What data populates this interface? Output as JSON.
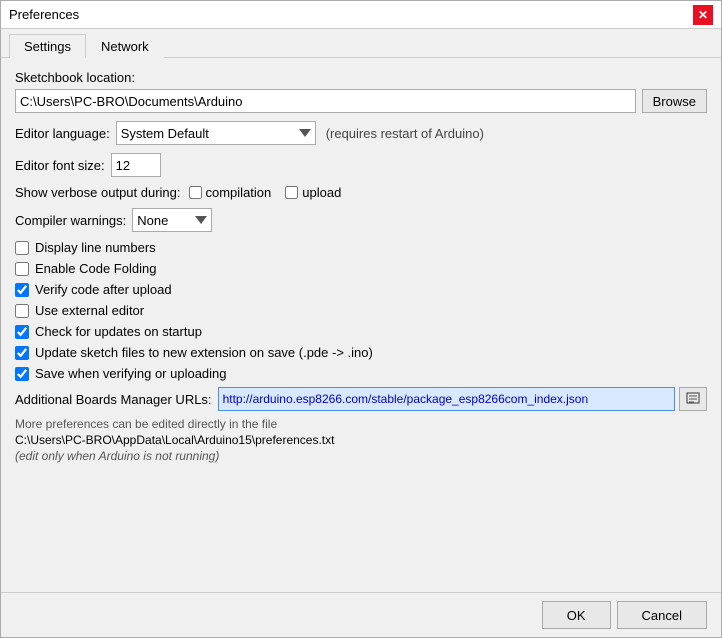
{
  "title_bar": {
    "title": "Preferences",
    "close_label": "✕"
  },
  "tabs": [
    {
      "id": "settings",
      "label": "Settings",
      "active": true
    },
    {
      "id": "network",
      "label": "Network",
      "active": false
    }
  ],
  "settings": {
    "sketchbook_label": "Sketchbook location:",
    "sketchbook_value": "C:\\Users\\PC-BRO\\Documents\\Arduino",
    "browse_label": "Browse",
    "editor_language_label": "Editor language:",
    "editor_language_value": "System Default",
    "editor_language_hint": "(requires restart of Arduino)",
    "editor_font_size_label": "Editor font size:",
    "editor_font_size_value": "12",
    "verbose_label": "Show verbose output during:",
    "compilation_label": "compilation",
    "upload_label": "upload",
    "compiler_warnings_label": "Compiler warnings:",
    "compiler_warnings_value": "None",
    "checkboxes": [
      {
        "id": "display_line_numbers",
        "label": "Display line numbers",
        "checked": false
      },
      {
        "id": "enable_code_folding",
        "label": "Enable Code Folding",
        "checked": false
      },
      {
        "id": "verify_code_after_upload",
        "label": "Verify code after upload",
        "checked": true
      },
      {
        "id": "use_external_editor",
        "label": "Use external editor",
        "checked": false
      },
      {
        "id": "check_for_updates",
        "label": "Check for updates on startup",
        "checked": true
      },
      {
        "id": "update_sketch_files",
        "label": "Update sketch files to new extension on save (.pde -> .ino)",
        "checked": true
      },
      {
        "id": "save_when_verifying",
        "label": "Save when verifying or uploading",
        "checked": true
      }
    ],
    "additional_boards_label": "Additional Boards Manager URLs:",
    "additional_boards_value": "http://arduino.esp8266.com/stable/package_esp8266com_index.json",
    "more_prefs_text": "More preferences can be edited directly in the file",
    "prefs_file_path": "C:\\Users\\PC-BRO\\AppData\\Local\\Arduino15\\preferences.txt",
    "edit_hint": "(edit only when Arduino is not running)"
  },
  "footer": {
    "ok_label": "OK",
    "cancel_label": "Cancel"
  }
}
